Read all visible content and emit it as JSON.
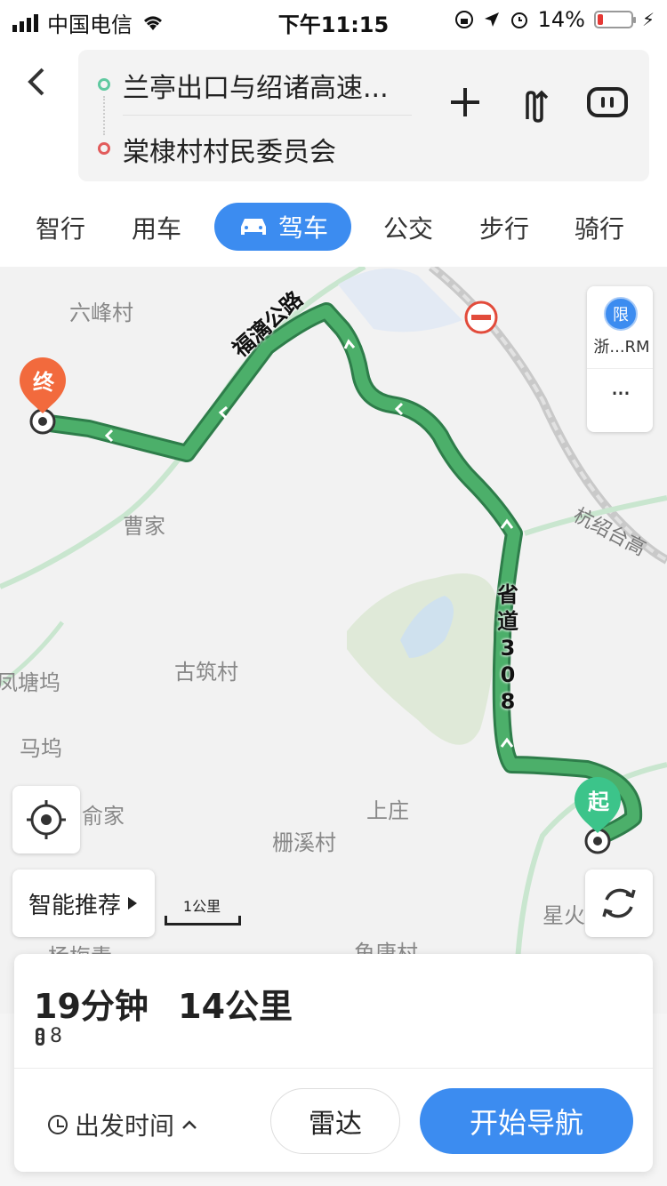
{
  "status": {
    "carrier": "中国电信",
    "time": "下午11:15",
    "battery": "14%"
  },
  "header": {
    "origin": "兰亭出口与绍诸高速...",
    "destination": "棠棣村村民委员会"
  },
  "modes": [
    "智行",
    "用车",
    "驾车",
    "公交",
    "步行",
    "骑行"
  ],
  "active_mode": "驾车",
  "map": {
    "labels": {
      "liufeng": "六峰村",
      "caojia": "曹家",
      "guzhu": "古筑村",
      "fengtangwu": "凤塘坞",
      "mawu": "马坞",
      "yujia": "俞家",
      "shangzhuang": "上庄",
      "zhaxi": "栅溪村",
      "xinghuo": "星火",
      "yangmeiqing": "杨梅青",
      "yutang": "鱼唐村"
    },
    "road_fuxi": "福漓公路",
    "road_308": "省道308",
    "road_hangshao": "杭绍台高",
    "end_marker": "终",
    "start_marker": "起",
    "restriction_badge": "限",
    "restriction_plate": "浙...RM",
    "more": "···",
    "smart_recommend": "智能推荐",
    "scale": "1公里"
  },
  "panel": {
    "duration": "19分钟",
    "distance": "14公里",
    "lights": "8",
    "depart": "出发时间",
    "radar": "雷达",
    "start_nav": "开始导航"
  },
  "colors": {
    "accent": "#3c8cf0",
    "route": "#4caf6a",
    "route_edge": "#2e7d4a",
    "end_marker": "#f26a3d",
    "start_marker": "#3cc48a"
  }
}
